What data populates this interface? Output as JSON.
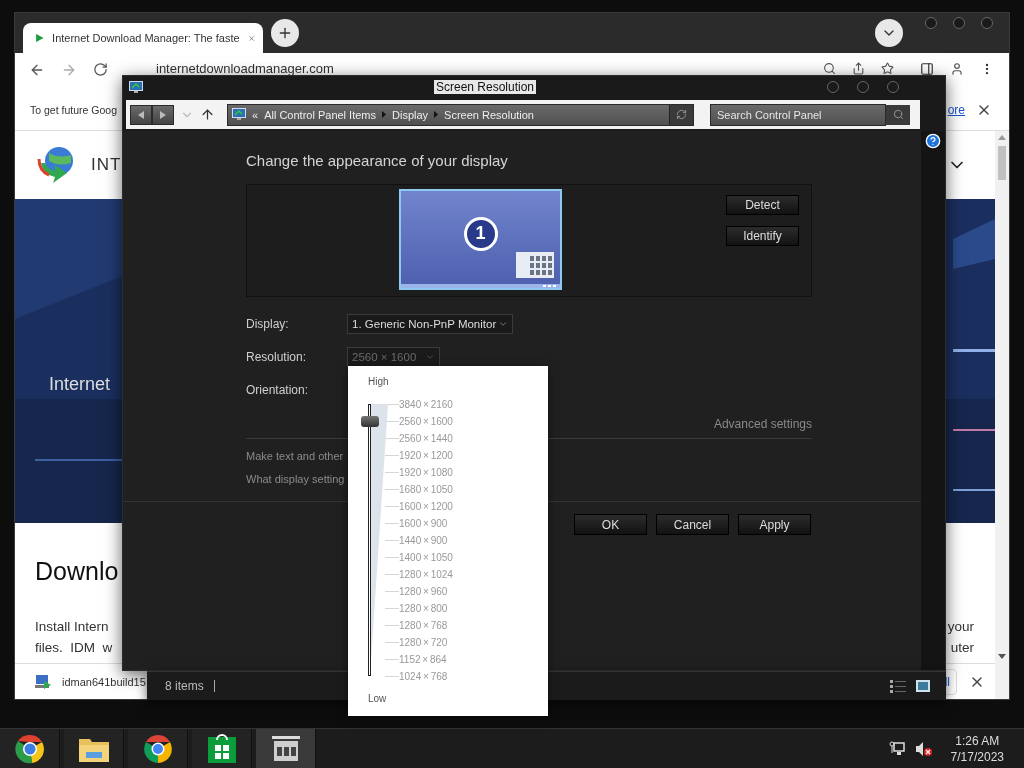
{
  "browser": {
    "tab": {
      "title": "Internet Download Manager: The faste",
      "selected": true
    },
    "address": "internetdownloadmanager.com",
    "info_bar": {
      "text": "To get future Goog",
      "link": "ore"
    },
    "page": {
      "header_text": "INT",
      "hero_text": "Internet",
      "heading": "Downlo",
      "body_left": [
        "Install Intern",
        "files.  IDM  w"
      ],
      "body_right": [
        "your",
        "uter"
      ]
    },
    "download_bar": {
      "file": "idman641build15",
      "link": "ll"
    }
  },
  "dialog": {
    "title": "Screen Resolution",
    "breadcrumb_prefix": "«",
    "breadcrumb": [
      "All Control Panel Items",
      "Display",
      "Screen Resolution"
    ],
    "search": {
      "placeholder": "Search Control Panel"
    },
    "heading": "Change the appearance of your display",
    "monitor_number": "1",
    "side_buttons": [
      "Detect",
      "Identify"
    ],
    "fields": [
      {
        "label": "Display:",
        "value": "1. Generic Non-PnP Monitor",
        "disabled": false
      },
      {
        "label": "Resolution:",
        "value": "2560 × 1600",
        "disabled": true
      },
      {
        "label": "Orientation:"
      }
    ],
    "advanced_link": "Advanced settings",
    "links": [
      "Make text and other",
      "What display setting"
    ],
    "buttons": [
      "OK",
      "Cancel",
      "Apply"
    ],
    "status": "8 items"
  },
  "resolution_popup": {
    "high_label": "High",
    "low_label": "Low",
    "level": 0.9375,
    "options": [
      "3840 × 2160",
      "2560 × 1600",
      "2560 × 1440",
      "1920 × 1200",
      "1920 × 1080",
      "1680 × 1050",
      "1600 × 1200",
      "1600 × 900",
      "1440 × 900",
      "1400 × 1050",
      "1280 × 1024",
      "1280 × 960",
      "1280 × 800",
      "1280 × 768",
      "1280 × 720",
      "1152 × 864",
      "1024 × 768"
    ]
  },
  "taskbar": {
    "items": [
      {
        "kind": "canary",
        "selected": false
      },
      {
        "kind": "folder",
        "selected": false
      },
      {
        "kind": "chrome",
        "selected": false
      },
      {
        "kind": "store",
        "selected": false
      },
      {
        "kind": "panel",
        "selected": true
      }
    ]
  },
  "clock": {
    "time": "1:26 AM",
    "date": "7/17/2023"
  }
}
